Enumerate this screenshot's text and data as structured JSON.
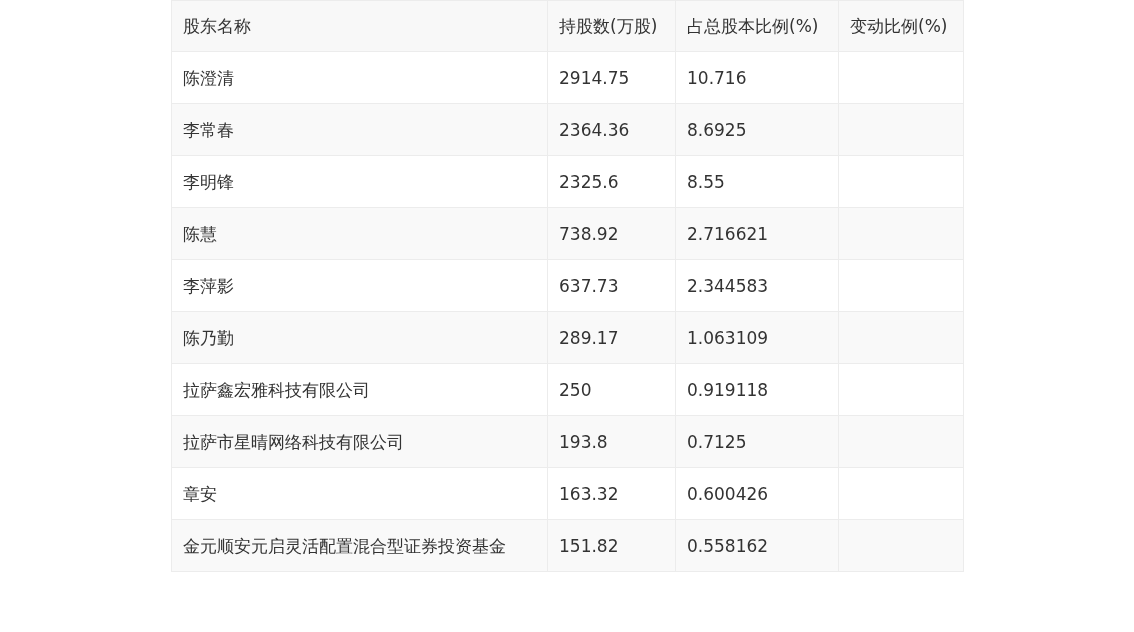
{
  "table": {
    "columns": [
      "股东名称",
      "持股数(万股)",
      "占总股本比例(%)",
      "变动比例(%)"
    ],
    "rows": [
      [
        "陈澄清",
        "2914.75",
        "10.716",
        ""
      ],
      [
        "李常春",
        "2364.36",
        "8.6925",
        ""
      ],
      [
        "李明锋",
        "2325.6",
        "8.55",
        ""
      ],
      [
        "陈慧",
        "738.92",
        "2.716621",
        ""
      ],
      [
        "李萍影",
        "637.73",
        "2.344583",
        ""
      ],
      [
        "陈乃勤",
        "289.17",
        "1.063109",
        ""
      ],
      [
        "拉萨鑫宏雅科技有限公司",
        "250",
        "0.919118",
        ""
      ],
      [
        "拉萨市星晴网络科技有限公司",
        "193.8",
        "0.7125",
        ""
      ],
      [
        "章安",
        "163.32",
        "0.600426",
        ""
      ],
      [
        "金元顺安元启灵活配置混合型证券投资基金",
        "151.82",
        "0.558162",
        ""
      ]
    ]
  }
}
